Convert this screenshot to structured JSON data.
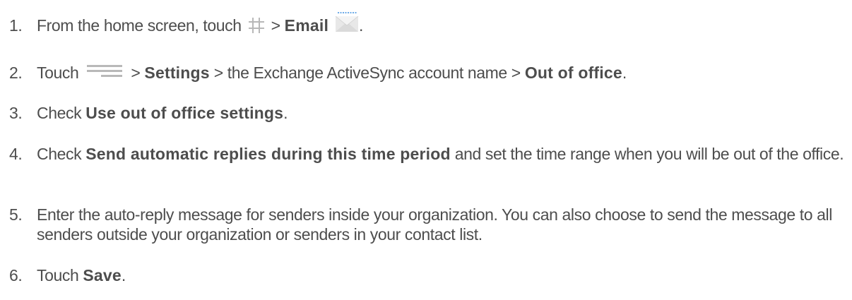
{
  "steps": [
    {
      "number": "1.",
      "text_a": "From the home screen, touch",
      "sep": ">",
      "bold_b": "Email",
      "end": "."
    },
    {
      "number": "2.",
      "text_a": "Touch",
      "sep1": ">",
      "bold_b": "Settings",
      "text_c": "> the Exchange ActiveSync account name >",
      "bold_d": "Out of office",
      "end": "."
    },
    {
      "number": "3.",
      "text_a": "Check",
      "bold_b": "Use out of office settings",
      "end": "."
    },
    {
      "number": "4.",
      "text_a": "Check",
      "bold_b": "Send automatic replies during this time period",
      "text_c": "and set the time range when you will be out of the office."
    },
    {
      "number": "5.",
      "text": "Enter the auto-reply message for senders inside your organization. You can also choose to send the message to all senders outside your organization or senders in your contact list."
    },
    {
      "number": "6.",
      "text_a": "Touch",
      "bold_b": "Save",
      "end": "."
    }
  ],
  "icons": {
    "apps": "apps-grid-icon",
    "email": "email-envelope-icon",
    "menu": "menu-icon"
  },
  "colors": {
    "text": "#4d4d4d",
    "icon_gray": "#b8b8b8",
    "envelope_blue": "#3d8fe0"
  }
}
